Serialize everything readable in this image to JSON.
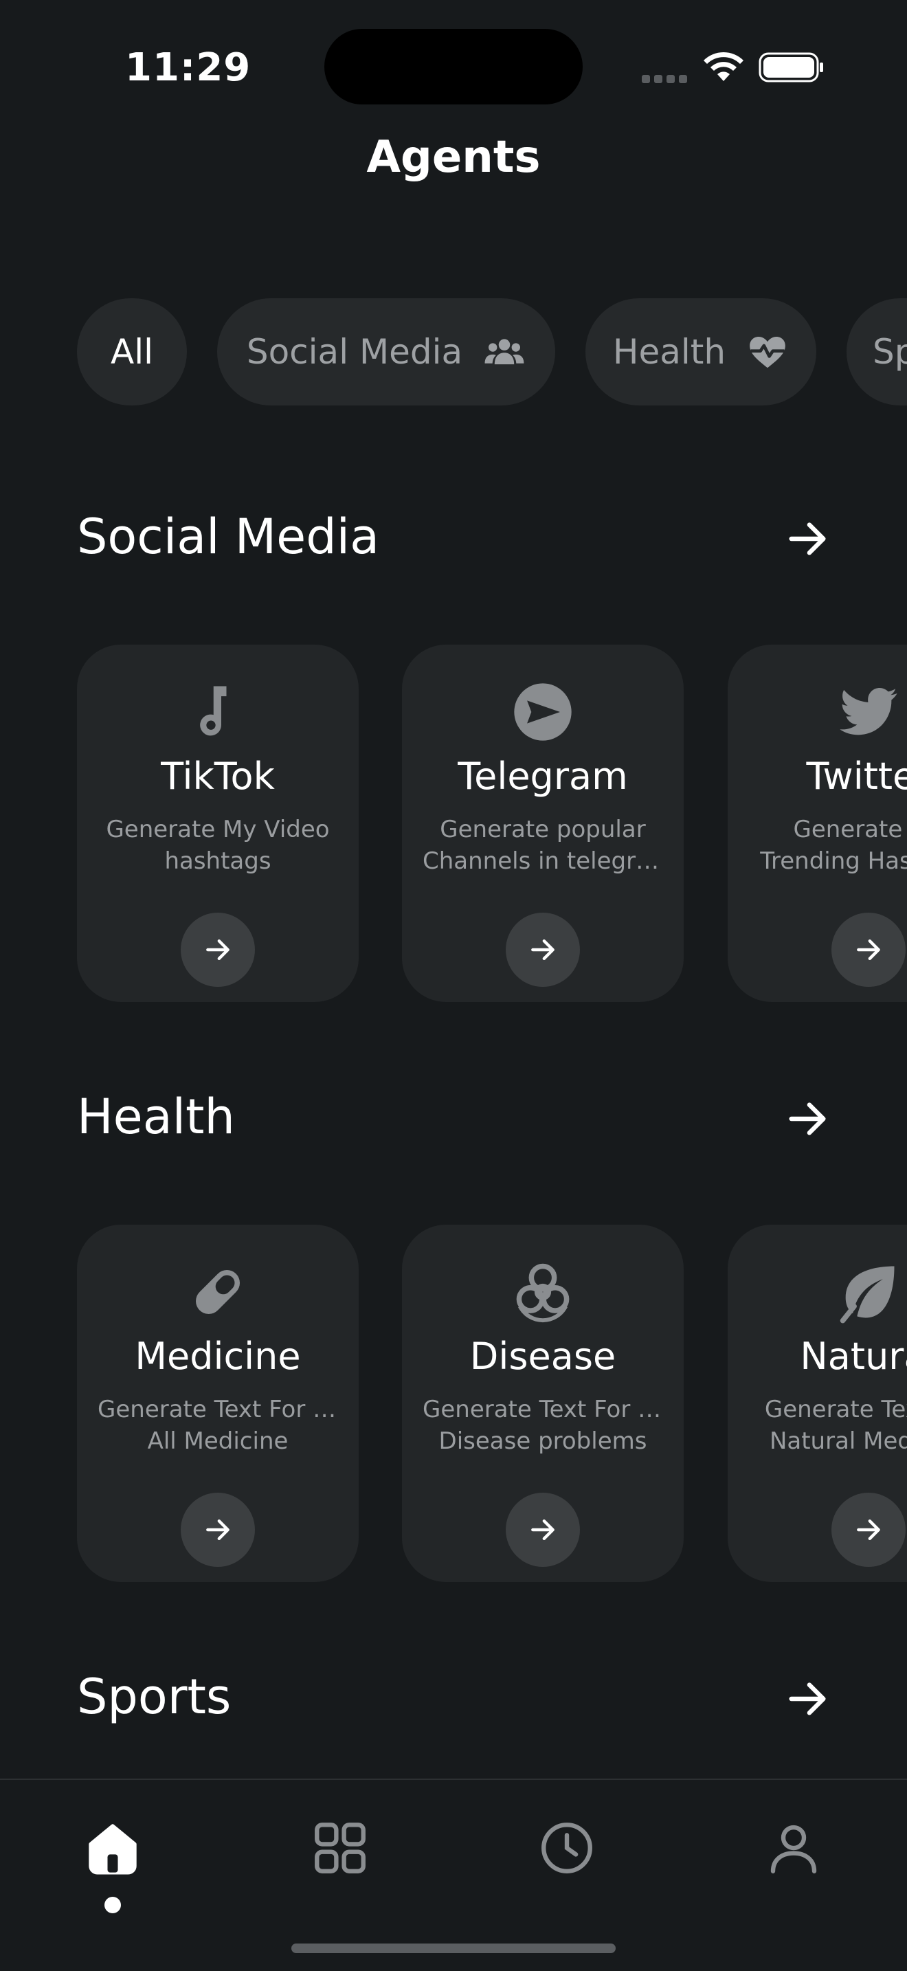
{
  "status": {
    "time": "11:29"
  },
  "header": {
    "title": "Agents"
  },
  "chips": [
    {
      "label": "All",
      "icon": null,
      "active": true
    },
    {
      "label": "Social Media",
      "icon": "people-icon",
      "active": false
    },
    {
      "label": "Health",
      "icon": "heart-pulse-icon",
      "active": false
    },
    {
      "label": "Sp",
      "icon": null,
      "active": false
    }
  ],
  "sections": [
    {
      "title": "Social Media",
      "cards": [
        {
          "title": "TikTok",
          "desc": [
            "Generate My Video",
            "hashtags"
          ],
          "icon": "music-note-icon"
        },
        {
          "title": "Telegram",
          "desc": [
            "Generate popular",
            "Channels in telegra…"
          ],
          "icon": "telegram-icon"
        },
        {
          "title": "Twitter",
          "desc": [
            "Generate My",
            "Trending Hashtags"
          ],
          "icon": "twitter-bird-icon"
        }
      ]
    },
    {
      "title": "Health",
      "cards": [
        {
          "title": "Medicine",
          "desc": [
            "Generate Text For My",
            "All Medicine"
          ],
          "icon": "pill-icon"
        },
        {
          "title": "Disease",
          "desc": [
            "Generate Text For All",
            "Disease problems"
          ],
          "icon": "biohazard-icon"
        },
        {
          "title": "Natural",
          "desc": [
            "Generate Text For",
            "Natural Medicine"
          ],
          "icon": "leaf-icon"
        }
      ]
    },
    {
      "title": "Sports",
      "cards": []
    }
  ],
  "nav": {
    "items": [
      {
        "name": "home",
        "icon": "home-icon",
        "active": true
      },
      {
        "name": "categories",
        "icon": "grid-icon",
        "active": false
      },
      {
        "name": "history",
        "icon": "clock-icon",
        "active": false
      },
      {
        "name": "profile",
        "icon": "user-icon",
        "active": false
      }
    ]
  },
  "colors": {
    "background": "#171a1c",
    "card": "#232628",
    "chip": "#26292b",
    "muted_text": "#9a9da0",
    "icon_gray": "#8a8d90"
  }
}
